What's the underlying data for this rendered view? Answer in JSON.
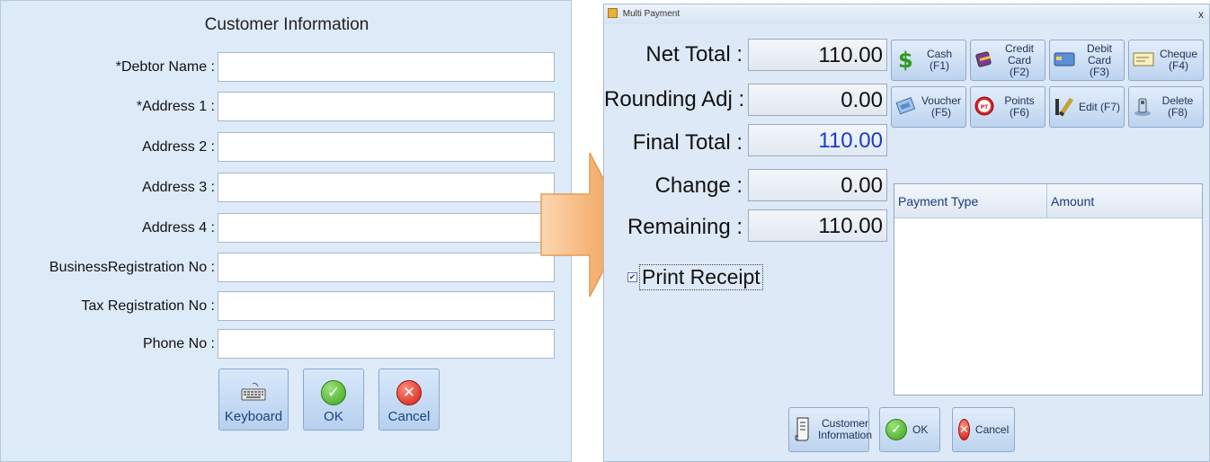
{
  "customer_form": {
    "title": "Customer Information",
    "fields": [
      {
        "label": "*Debtor Name :",
        "value": ""
      },
      {
        "label": "*Address 1 :",
        "value": ""
      },
      {
        "label": "Address 2 :",
        "value": ""
      },
      {
        "label": "Address 3 :",
        "value": ""
      },
      {
        "label": "Address 4 :",
        "value": ""
      },
      {
        "label": "BusinessRegistration No :",
        "value": ""
      },
      {
        "label": "Tax Registration No :",
        "value": ""
      },
      {
        "label": "Phone No :",
        "value": ""
      }
    ],
    "buttons": {
      "keyboard": "Keyboard",
      "ok": "OK",
      "cancel": "Cancel"
    }
  },
  "multi_payment": {
    "window_title": "Multi Payment",
    "close_label": "x",
    "summary": {
      "net_total": {
        "label": "Net Total :",
        "value": "110.00"
      },
      "rounding_adj": {
        "label": "Rounding Adj :",
        "value": "0.00"
      },
      "final_total": {
        "label": "Final Total :",
        "value": "110.00"
      },
      "change": {
        "label": "Change :",
        "value": "0.00"
      },
      "remaining": {
        "label": "Remaining :",
        "value": "110.00"
      }
    },
    "payment_buttons": {
      "cash": "Cash (F1)",
      "credit_card": "Credit Card (F2)",
      "debit_card": "Debit Card (F3)",
      "cheque": "Cheque (F4)",
      "voucher": "Voucher (F5)",
      "points": "Points (F6)",
      "edit": "Edit (F7)",
      "delete": "Delete (F8)"
    },
    "print_receipt": {
      "label": "Print Receipt",
      "checked": true,
      "mark": "✔"
    },
    "grid": {
      "columns": [
        "Payment Type",
        "Amount"
      ],
      "rows": []
    },
    "bottom_buttons": {
      "customer_info": "Customer Information",
      "ok": "OK",
      "cancel": "Cancel"
    }
  },
  "icons": {
    "keyboard": "keyboard-icon",
    "ok": "check-circle-icon",
    "cancel": "x-circle-icon",
    "cash": "dollar-icon",
    "credit_card": "credit-card-icon",
    "debit_card": "debit-card-icon",
    "cheque": "cheque-icon",
    "voucher": "voucher-icon",
    "points": "points-icon",
    "edit": "edit-icon",
    "delete": "delete-icon",
    "customer_info": "document-icon"
  },
  "colors": {
    "accent_blue": "#1a3cc8",
    "panel_bg": "#ddeaf8",
    "arrow": "#f4b06a"
  }
}
